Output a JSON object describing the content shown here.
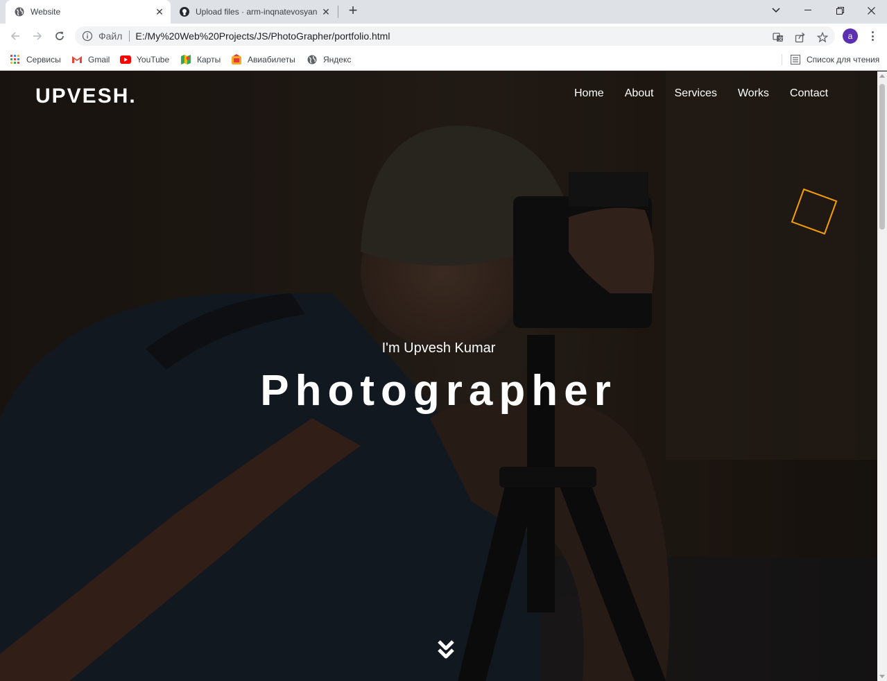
{
  "browser": {
    "tabs": [
      {
        "title": "Website",
        "icon": "globe-icon",
        "active": true
      },
      {
        "title": "Upload files · arm-inqnatevosyan",
        "icon": "github-icon",
        "active": false
      }
    ],
    "address": {
      "scheme_label": "Файл",
      "url": "E:/My%20Web%20Projects/JS/PhotoGrapher/portfolio.html"
    },
    "avatar_letter": "a",
    "avatar_color": "#5b2fb0",
    "bookmarks": [
      {
        "label": "Сервисы",
        "icon": "apps-grid-icon"
      },
      {
        "label": "Gmail",
        "icon": "gmail-icon"
      },
      {
        "label": "YouTube",
        "icon": "youtube-icon"
      },
      {
        "label": "Карты",
        "icon": "maps-icon"
      },
      {
        "label": "Авиабилеты",
        "icon": "flight-tickets-icon"
      },
      {
        "label": "Яндекс",
        "icon": "globe-icon"
      }
    ],
    "reading_list": "Список для чтения"
  },
  "site": {
    "brand": "UPVESH.",
    "nav": [
      "Home",
      "About",
      "Services",
      "Works",
      "Contact"
    ],
    "hero": {
      "subtitle": "I'm Upvesh Kumar",
      "headline": "Photographer"
    },
    "accent_color": "#f5a000"
  }
}
